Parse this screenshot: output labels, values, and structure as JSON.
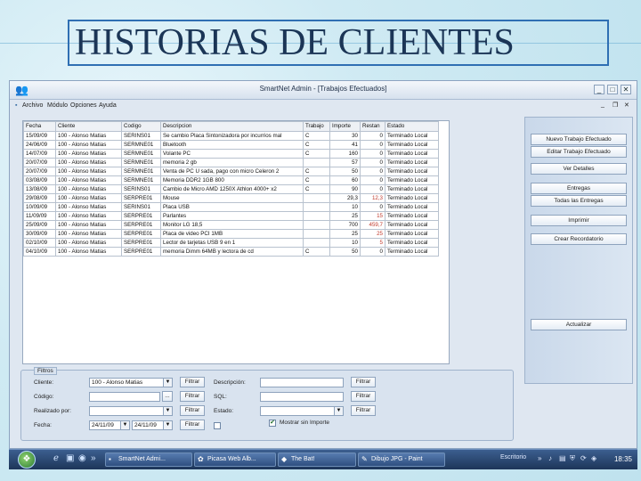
{
  "slide": {
    "title": "HISTORIAS DE CLIENTES"
  },
  "window": {
    "title": "SmartNet Admin - [Trabajos Efectuados]",
    "controls": {
      "minimize": "_",
      "maximize": "□",
      "close": "✕"
    },
    "child_controls": {
      "minimize": "_",
      "restore": "❐",
      "close": "✕"
    }
  },
  "menu": [
    "Archivo",
    "Módulo",
    "Opciones",
    "Ayuda"
  ],
  "table": {
    "columns": [
      "Fecha",
      "Cliente",
      "Codigo",
      "Descripcion",
      "Trabajo",
      "Importe",
      "Restan",
      "Estado"
    ],
    "rows": [
      [
        "15/09/09",
        "100 - Alonso Matias",
        "SERINS01",
        "Se cambio Placa Sintonizadora por incurrios mal",
        "C",
        "30",
        "0",
        "Terminado Local"
      ],
      [
        "24/06/09",
        "100 - Alonso Matias",
        "SERMNE01",
        "Bluetooth",
        "C",
        "41",
        "0",
        "Terminado Local"
      ],
      [
        "14/07/09",
        "100 - Alonso Matias",
        "SERMNE01",
        "Volante PC",
        "C",
        "160",
        "0",
        "Terminado Local"
      ],
      [
        "20/07/09",
        "100 - Alonso Matias",
        "SERMNE01",
        "memoria 2 gb",
        "",
        "57",
        "0",
        "Terminado Local"
      ],
      [
        "20/07/09",
        "100 - Alonso Matias",
        "SERMNE01",
        "Venta de PC U sada, pago con micro Celeron 2",
        "C",
        "50",
        "0",
        "Terminado Local"
      ],
      [
        "03/08/09",
        "100 - Alonso Matias",
        "SERMNE01",
        "Memoria DDR2 1GB 800",
        "C",
        "60",
        "0",
        "Terminado Local"
      ],
      [
        "13/08/09",
        "100 - Alonso Matias",
        "SERINS01",
        "Cambio de Micro AMD 1250X Athlon 4000+ x2",
        "C",
        "90",
        "0",
        "Terminado Local"
      ],
      [
        "29/08/09",
        "100 - Alonso Matias",
        "SERPRE01",
        "Mouse",
        "",
        "29,3",
        "12,3",
        "Terminado Local"
      ],
      [
        "10/09/09",
        "100 - Alonso Matias",
        "SERINS01",
        "Placa USB",
        "",
        "10",
        "0",
        "Terminado Local"
      ],
      [
        "11/09/09",
        "100 - Alonso Matias",
        "SERPRE01",
        "Parlantes",
        "",
        "25",
        "15",
        "Terminado Local"
      ],
      [
        "25/09/09",
        "100 - Alonso Matias",
        "SERPRE01",
        "Monitor LG 18,5",
        "",
        "700",
        "459,7",
        "Terminado Local"
      ],
      [
        "30/09/09",
        "100 - Alonso Matias",
        "SERPRE01",
        "Placa de video PCI 1MB",
        "",
        "25",
        "25",
        "Terminado Local"
      ],
      [
        "02/10/09",
        "100 - Alonso Matias",
        "SERPRE01",
        "Lector de tarjetas USB 9 en 1",
        "",
        "10",
        "5",
        "Terminado Local"
      ],
      [
        "04/10/09",
        "100 - Alonso Matias",
        "SERPRE01",
        "memoria Dimm 64MB y lectora de cd",
        "C",
        "50",
        "0",
        "Terminado Local"
      ]
    ],
    "red_rows_restan": [
      7,
      9,
      10,
      11,
      12
    ]
  },
  "sidebar": {
    "buttons": [
      "Nuevo Trabajo Efectuado",
      "Editar Trabajo Efectuado",
      "Ver Detalles",
      "Entregas",
      "Todas las Entregas",
      "Imprimir",
      "Crear Recordatorio",
      "Actualizar"
    ]
  },
  "filters": {
    "legend": "Filtros",
    "cliente_label": "Cliente:",
    "cliente_value": "100 - Alonso Matias",
    "codigo_label": "Código:",
    "codigo_button": "...",
    "realizado_label": "Realizado por:",
    "fecha_label": "Fecha:",
    "fecha_desde": "24/11/09",
    "fecha_hasta": "24/11/09",
    "descripcion_label": "Descripción:",
    "sql_label": "SQL:",
    "estado_label": "Estado:",
    "filtrar": "Filtrar",
    "mostrar_sin_importe": "Mostrar sin Importe"
  },
  "taskbar": {
    "tasks": [
      "SmartNet Admi...",
      "Picasa Web Alb...",
      "The Bat!",
      "Dibujo JPG - Paint"
    ],
    "desktop": "Escritorio",
    "clock": "18:35"
  }
}
